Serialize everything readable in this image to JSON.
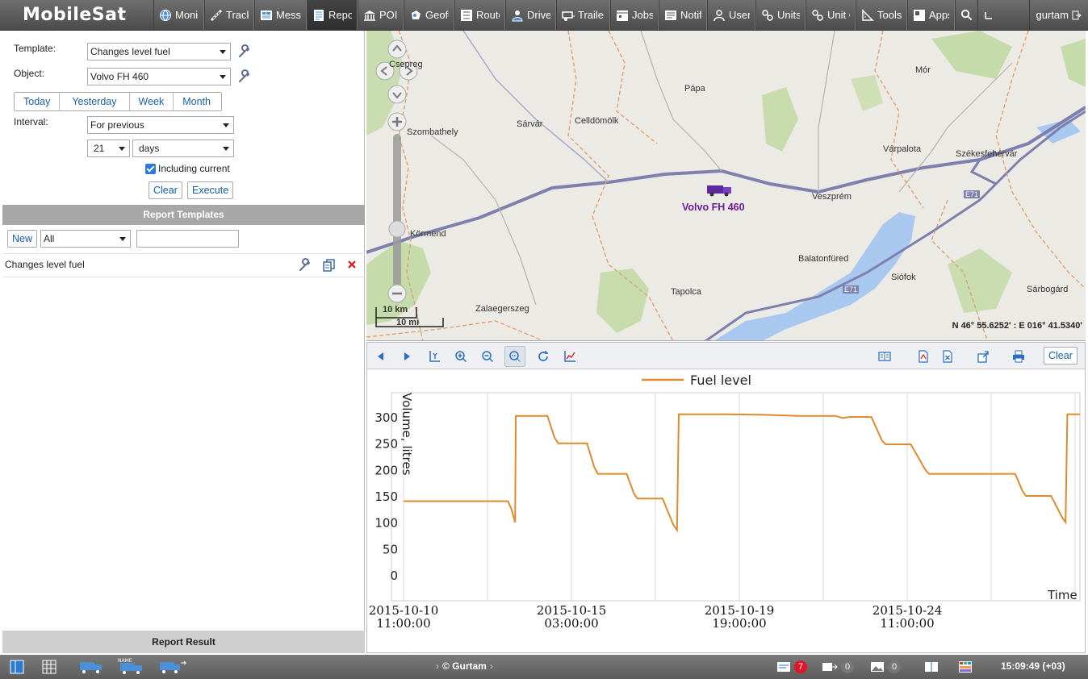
{
  "app": {
    "logo": "MobileSat"
  },
  "nav": [
    {
      "label": "Moni",
      "icon": "globe-icon"
    },
    {
      "label": "Track",
      "icon": "tracks-icon"
    },
    {
      "label": "Mess",
      "icon": "messages-icon"
    },
    {
      "label": "Repo",
      "icon": "reports-icon",
      "active": true
    },
    {
      "label": "POI",
      "icon": "poi-icon"
    },
    {
      "label": "Geofe",
      "icon": "geofence-icon"
    },
    {
      "label": "Route",
      "icon": "routes-icon"
    },
    {
      "label": "Drive",
      "icon": "driver-icon"
    },
    {
      "label": "Traile",
      "icon": "trailer-icon"
    },
    {
      "label": "Jobs",
      "icon": "jobs-icon"
    },
    {
      "label": "Notifi",
      "icon": "notifications-icon"
    },
    {
      "label": "Users",
      "icon": "users-icon"
    },
    {
      "label": "Units",
      "icon": "units-icon"
    },
    {
      "label": "Unit C",
      "icon": "unit-groups-icon"
    },
    {
      "label": "Tools",
      "icon": "tools-icon"
    },
    {
      "label": "Apps",
      "icon": "apps-icon"
    }
  ],
  "user": {
    "name": "gurtam"
  },
  "form": {
    "template_label": "Template:",
    "template_value": "Changes level fuel",
    "object_label": "Object:",
    "object_value": "Volvo FH 460",
    "quick_periods": [
      "Today",
      "Yesterday",
      "Week",
      "Month"
    ],
    "interval_label": "Interval:",
    "interval_value": "For previous",
    "interval_count": "21",
    "interval_unit": "days",
    "including_current": "Including current",
    "clear": "Clear",
    "execute": "Execute"
  },
  "templates": {
    "header": "Report Templates",
    "new": "New",
    "filter_value": "All",
    "items": [
      "Changes level fuel"
    ]
  },
  "result": {
    "header": "Report Result"
  },
  "map": {
    "places": [
      "Csepreg",
      "Pápa",
      "Mór",
      "Sárvár",
      "Celldömölk",
      "Szombathely",
      "Várpalota",
      "Székesfehérvár",
      "Veszprém",
      "Körmend",
      "Balatonfüred",
      "Siófok",
      "Tapolca",
      "Zalaegerszeg",
      "Sárbogárd",
      "E71",
      "E71"
    ],
    "unit_label": "Volvo FH 460",
    "scale_km": "10 km",
    "scale_mi": "10 mi",
    "coords": "N 46° 55.6252' : E 016° 41.5340'"
  },
  "chart_toolbar": {
    "clear": "Clear"
  },
  "chart_data": {
    "type": "line",
    "legend": "Fuel level",
    "ylabel": "Volume, litres",
    "xlabel": "Time",
    "ylim": [
      0,
      310
    ],
    "yticks": [
      0,
      50,
      100,
      150,
      200,
      250,
      300
    ],
    "xticks": [
      {
        "label1": "2015-10-10",
        "label2": "11:00:00",
        "pos": 0
      },
      {
        "label1": "2015-10-15",
        "label2": "03:00:00",
        "pos": 4.667
      },
      {
        "label1": "2015-10-19",
        "label2": "19:00:00",
        "pos": 9.333
      },
      {
        "label1": "2015-10-24",
        "label2": "11:00:00",
        "pos": 14.0
      }
    ],
    "xlim": [
      0,
      18.8
    ],
    "series": [
      {
        "name": "Fuel level",
        "color": "#e08a2c",
        "points": [
          [
            0.0,
            140
          ],
          [
            2.9,
            140
          ],
          [
            3.0,
            125
          ],
          [
            3.1,
            100
          ],
          [
            3.12,
            302
          ],
          [
            4.0,
            302
          ],
          [
            4.2,
            260
          ],
          [
            4.3,
            250
          ],
          [
            5.1,
            250
          ],
          [
            5.3,
            205
          ],
          [
            5.4,
            192
          ],
          [
            6.2,
            192
          ],
          [
            6.4,
            155
          ],
          [
            6.5,
            145
          ],
          [
            7.2,
            145
          ],
          [
            7.5,
            95
          ],
          [
            7.6,
            85
          ],
          [
            7.65,
            305
          ],
          [
            9.0,
            305
          ],
          [
            10.0,
            304
          ],
          [
            11.0,
            302
          ],
          [
            12.0,
            302
          ],
          [
            12.2,
            298
          ],
          [
            12.4,
            300
          ],
          [
            13.0,
            300
          ],
          [
            13.3,
            255
          ],
          [
            13.4,
            248
          ],
          [
            14.1,
            248
          ],
          [
            14.5,
            200
          ],
          [
            14.6,
            192
          ],
          [
            17.0,
            192
          ],
          [
            17.2,
            160
          ],
          [
            17.3,
            150
          ],
          [
            18.0,
            150
          ],
          [
            18.3,
            110
          ],
          [
            18.4,
            100
          ],
          [
            18.45,
            305
          ],
          [
            18.8,
            305
          ]
        ]
      }
    ]
  },
  "status": {
    "copyright": "© Gurtam",
    "messages_count": "7",
    "events_count": "0",
    "media_count": "0",
    "time": "15:09:49 (+03)"
  }
}
